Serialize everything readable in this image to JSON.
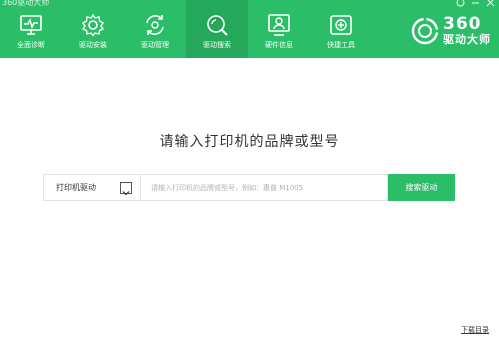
{
  "window": {
    "title": "360驱动大师",
    "controls": [
      "menu-icon",
      "minimize-icon",
      "close-icon"
    ]
  },
  "nav": [
    {
      "label": "全面诊断",
      "icon": "monitor-pulse-icon",
      "active": false
    },
    {
      "label": "驱动安装",
      "icon": "gear-icon",
      "active": false
    },
    {
      "label": "驱动管理",
      "icon": "refresh-gear-icon",
      "active": false
    },
    {
      "label": "驱动搜索",
      "icon": "search-icon",
      "active": true
    },
    {
      "label": "硬件信息",
      "icon": "monitor-person-icon",
      "active": false
    },
    {
      "label": "快捷工具",
      "icon": "toolbox-icon",
      "active": false
    }
  ],
  "brand": {
    "number": "360",
    "name": "驱动大师",
    "icon": "brand-logo-icon"
  },
  "main": {
    "prompt": "请输入打印机的品牌或型号",
    "select": {
      "value": "打印机驱动"
    },
    "search": {
      "placeholder": "请输入打印机的品牌或型号，例如：惠普 M1005"
    },
    "search_button": "搜索驱动",
    "download_link": "下载目录"
  },
  "colors": {
    "accent": "#2cbd68",
    "accent_active": "#25a85c",
    "text": "#333333",
    "border": "#e3e3e3"
  }
}
